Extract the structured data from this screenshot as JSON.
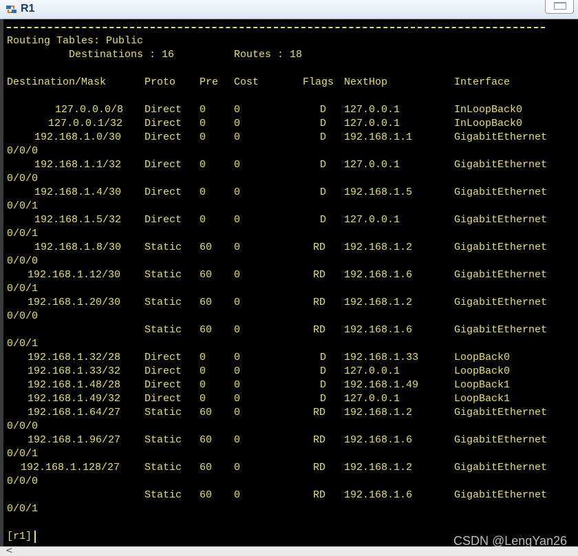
{
  "window": {
    "title": "R1",
    "icon": "router-terminal-icon"
  },
  "header": {
    "table_title": "Routing Tables: Public",
    "destinations_label": "Destinations : 16",
    "routes_label": "Routes : 18"
  },
  "columns": [
    "Destination/Mask",
    "Proto",
    "Pre",
    "Cost",
    "Flags",
    "NextHop",
    "Interface"
  ],
  "routes": [
    {
      "dest": "127.0.0.0/8",
      "proto": "Direct",
      "pre": "0",
      "cost": "0",
      "flags": "D",
      "nexthop": "127.0.0.1",
      "iface": "InLoopBack0",
      "wrap": ""
    },
    {
      "dest": "127.0.0.1/32",
      "proto": "Direct",
      "pre": "0",
      "cost": "0",
      "flags": "D",
      "nexthop": "127.0.0.1",
      "iface": "InLoopBack0",
      "wrap": ""
    },
    {
      "dest": "192.168.1.0/30",
      "proto": "Direct",
      "pre": "0",
      "cost": "0",
      "flags": "D",
      "nexthop": "192.168.1.1",
      "iface": "GigabitEthernet",
      "wrap": "0/0/0"
    },
    {
      "dest": "192.168.1.1/32",
      "proto": "Direct",
      "pre": "0",
      "cost": "0",
      "flags": "D",
      "nexthop": "127.0.0.1",
      "iface": "GigabitEthernet",
      "wrap": "0/0/0"
    },
    {
      "dest": "192.168.1.4/30",
      "proto": "Direct",
      "pre": "0",
      "cost": "0",
      "flags": "D",
      "nexthop": "192.168.1.5",
      "iface": "GigabitEthernet",
      "wrap": "0/0/1"
    },
    {
      "dest": "192.168.1.5/32",
      "proto": "Direct",
      "pre": "0",
      "cost": "0",
      "flags": "D",
      "nexthop": "127.0.0.1",
      "iface": "GigabitEthernet",
      "wrap": "0/0/1"
    },
    {
      "dest": "192.168.1.8/30",
      "proto": "Static",
      "pre": "60",
      "cost": "0",
      "flags": "RD",
      "nexthop": "192.168.1.2",
      "iface": "GigabitEthernet",
      "wrap": "0/0/0"
    },
    {
      "dest": "192.168.1.12/30",
      "proto": "Static",
      "pre": "60",
      "cost": "0",
      "flags": "RD",
      "nexthop": "192.168.1.6",
      "iface": "GigabitEthernet",
      "wrap": "0/0/1"
    },
    {
      "dest": "192.168.1.20/30",
      "proto": "Static",
      "pre": "60",
      "cost": "0",
      "flags": "RD",
      "nexthop": "192.168.1.2",
      "iface": "GigabitEthernet",
      "wrap": "0/0/0"
    },
    {
      "dest": "",
      "proto": "Static",
      "pre": "60",
      "cost": "0",
      "flags": "RD",
      "nexthop": "192.168.1.6",
      "iface": "GigabitEthernet",
      "wrap": "0/0/1"
    },
    {
      "dest": "192.168.1.32/28",
      "proto": "Direct",
      "pre": "0",
      "cost": "0",
      "flags": "D",
      "nexthop": "192.168.1.33",
      "iface": "LoopBack0",
      "wrap": ""
    },
    {
      "dest": "192.168.1.33/32",
      "proto": "Direct",
      "pre": "0",
      "cost": "0",
      "flags": "D",
      "nexthop": "127.0.0.1",
      "iface": "LoopBack0",
      "wrap": ""
    },
    {
      "dest": "192.168.1.48/28",
      "proto": "Direct",
      "pre": "0",
      "cost": "0",
      "flags": "D",
      "nexthop": "192.168.1.49",
      "iface": "LoopBack1",
      "wrap": ""
    },
    {
      "dest": "192.168.1.49/32",
      "proto": "Direct",
      "pre": "0",
      "cost": "0",
      "flags": "D",
      "nexthop": "127.0.0.1",
      "iface": "LoopBack1",
      "wrap": ""
    },
    {
      "dest": "192.168.1.64/27",
      "proto": "Static",
      "pre": "60",
      "cost": "0",
      "flags": "RD",
      "nexthop": "192.168.1.2",
      "iface": "GigabitEthernet",
      "wrap": "0/0/0"
    },
    {
      "dest": "192.168.1.96/27",
      "proto": "Static",
      "pre": "60",
      "cost": "0",
      "flags": "RD",
      "nexthop": "192.168.1.6",
      "iface": "GigabitEthernet",
      "wrap": "0/0/1"
    },
    {
      "dest": "192.168.1.128/27",
      "proto": "Static",
      "pre": "60",
      "cost": "0",
      "flags": "RD",
      "nexthop": "192.168.1.2",
      "iface": "GigabitEthernet",
      "wrap": "0/0/0"
    },
    {
      "dest": "",
      "proto": "Static",
      "pre": "60",
      "cost": "0",
      "flags": "RD",
      "nexthop": "192.168.1.6",
      "iface": "GigabitEthernet",
      "wrap": "0/0/1"
    }
  ],
  "prompt": "[r1]",
  "watermark": "CSDN @LengYan26",
  "scrollbar": {
    "left_arrow": "<"
  },
  "colors": {
    "terminal_bg": "#000000",
    "terminal_text": "#e6e15a"
  }
}
